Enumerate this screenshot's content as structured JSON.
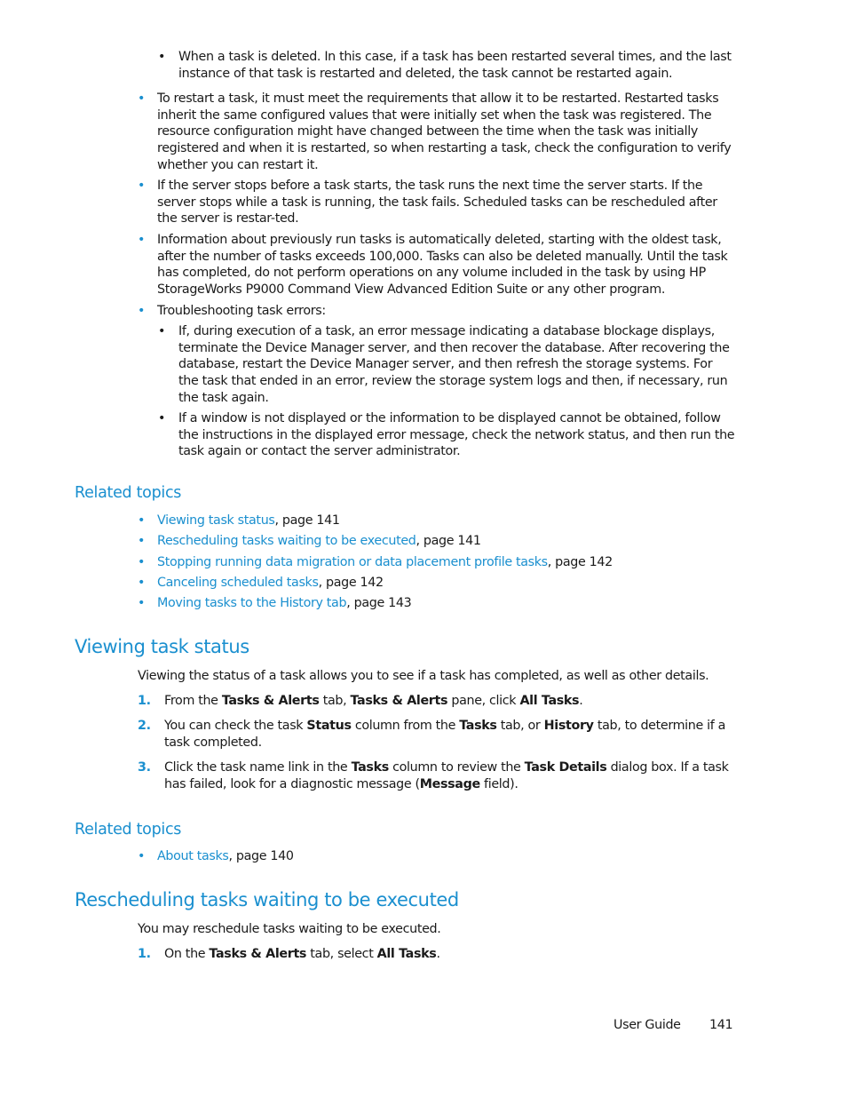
{
  "bullets_top": [
    {
      "level": 2,
      "text": "When a task is deleted. In this case, if a task has been restarted several times, and the last instance of that task is restarted and deleted, the task cannot be restarted again."
    },
    {
      "level": 1,
      "text": "To restart a task, it must meet the requirements that allow it to be restarted. Restarted tasks inherit the same configured values that were initially set when the task was registered. The resource configuration might have changed between the time when the task was initially registered and when it is restarted, so when restarting a task, check the configuration to verify whether you can restart it."
    },
    {
      "level": 1,
      "text": "If the server stops before a task starts, the task runs the next time the server starts. If the server stops while a task is running, the task fails. Scheduled tasks can be rescheduled after the server is restar-ted."
    },
    {
      "level": 1,
      "text": "Information about previously run tasks is automatically deleted, starting with the oldest task, after the number of tasks exceeds 100,000. Tasks can also be deleted manually. Until the task has completed, do not perform operations on any volume included in the task by using HP StorageWorks P9000 Command View Advanced Edition Suite or any other program."
    },
    {
      "level": 1,
      "text": "Troubleshooting task errors:"
    },
    {
      "level": 2,
      "text": "If, during execution of a task, an error message indicating a database blockage displays, terminate the Device Manager server, and then recover the database. After recovering the database, restart the Device Manager server, and then refresh the storage systems. For the task that ended in an error, review the storage system logs and then, if necessary, run the task again."
    },
    {
      "level": 2,
      "text": "If a window is not displayed or the information to be displayed cannot be obtained, follow the instructions in the displayed error message, check the network status, and then run the task again or contact the server administrator."
    }
  ],
  "related1": {
    "heading": "Related topics",
    "links": [
      {
        "link": "Viewing task status",
        "suffix": ", page 141"
      },
      {
        "link": "Rescheduling tasks waiting to be executed",
        "suffix": ", page 141"
      },
      {
        "link": "Stopping running data migration or data placement profile tasks",
        "suffix": ", page 142"
      },
      {
        "link": "Canceling scheduled tasks",
        "suffix": ", page 142"
      },
      {
        "link": "Moving tasks to the History tab",
        "suffix": ", page 143"
      }
    ]
  },
  "section_viewing": {
    "title": "Viewing task status",
    "intro": "Viewing the status of a task allows you to see if a task has completed, as well as other details.",
    "steps": [
      {
        "num": "1.",
        "parts": [
          "From the ",
          "Tasks & Alerts",
          " tab, ",
          "Tasks & Alerts",
          " pane, click ",
          "All Tasks",
          "."
        ]
      },
      {
        "num": "2.",
        "parts": [
          "You can check the task ",
          "Status",
          " column from the ",
          "Tasks",
          " tab, or ",
          "History",
          " tab, to determine if a task completed."
        ]
      },
      {
        "num": "3.",
        "parts": [
          "Click the task name link in the ",
          "Tasks",
          " column to review the ",
          "Task Details",
          " dialog box. If a task has failed, look for a diagnostic message (",
          "Message",
          " field)."
        ]
      }
    ]
  },
  "related2": {
    "heading": "Related topics",
    "links": [
      {
        "link": "About tasks",
        "suffix": ", page 140"
      }
    ]
  },
  "section_rescheduling": {
    "title": "Rescheduling tasks waiting to be executed",
    "intro": "You may reschedule tasks waiting to be executed.",
    "steps": [
      {
        "num": "1.",
        "parts": [
          "On the ",
          "Tasks & Alerts",
          " tab, select ",
          "All Tasks",
          "."
        ]
      }
    ]
  },
  "footer": {
    "label": "User Guide",
    "page": "141"
  },
  "bullet_glyph": "•"
}
